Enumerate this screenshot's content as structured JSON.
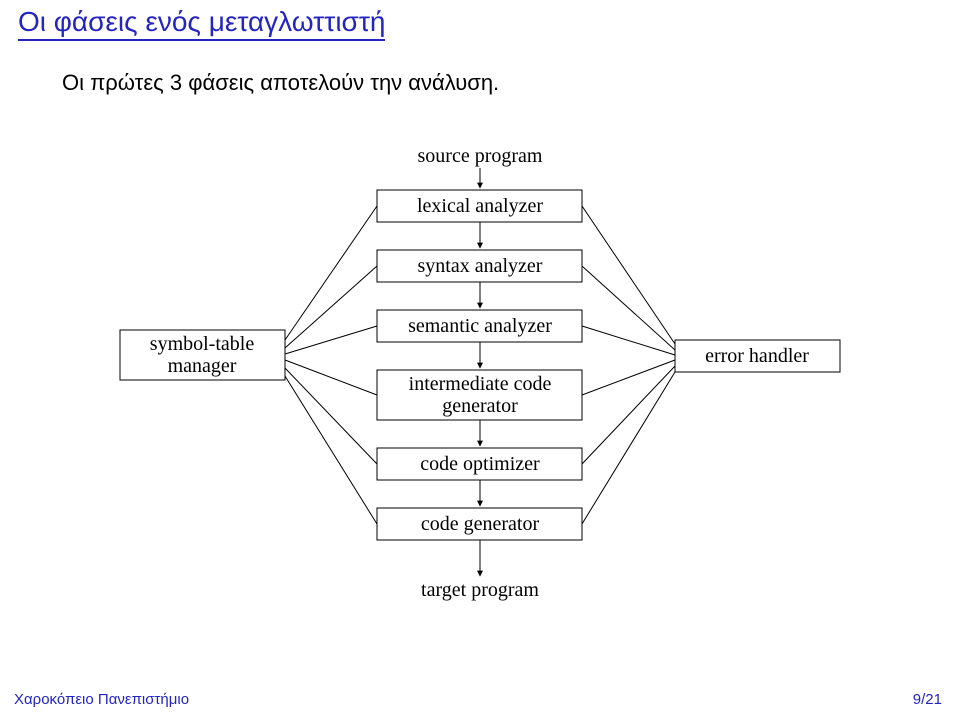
{
  "title": "Οι φάσεις ενός μεταγλωττιστή",
  "subtitle": "Οι πρώτες 3 φάσεις αποτελούν την ανάλυση.",
  "diagram": {
    "source": "source program",
    "phase1": "lexical analyzer",
    "phase2": "syntax analyzer",
    "phase3": "semantic analyzer",
    "phase4_line1": "intermediate code",
    "phase4_line2": "generator",
    "phase5": "code optimizer",
    "phase6": "code generator",
    "target": "target program",
    "left_line1": "symbol-table",
    "left_line2": "manager",
    "right": "error handler"
  },
  "footer_left": "Χαροκόπειο Πανεπιστήμιο",
  "footer_right": "9/21"
}
